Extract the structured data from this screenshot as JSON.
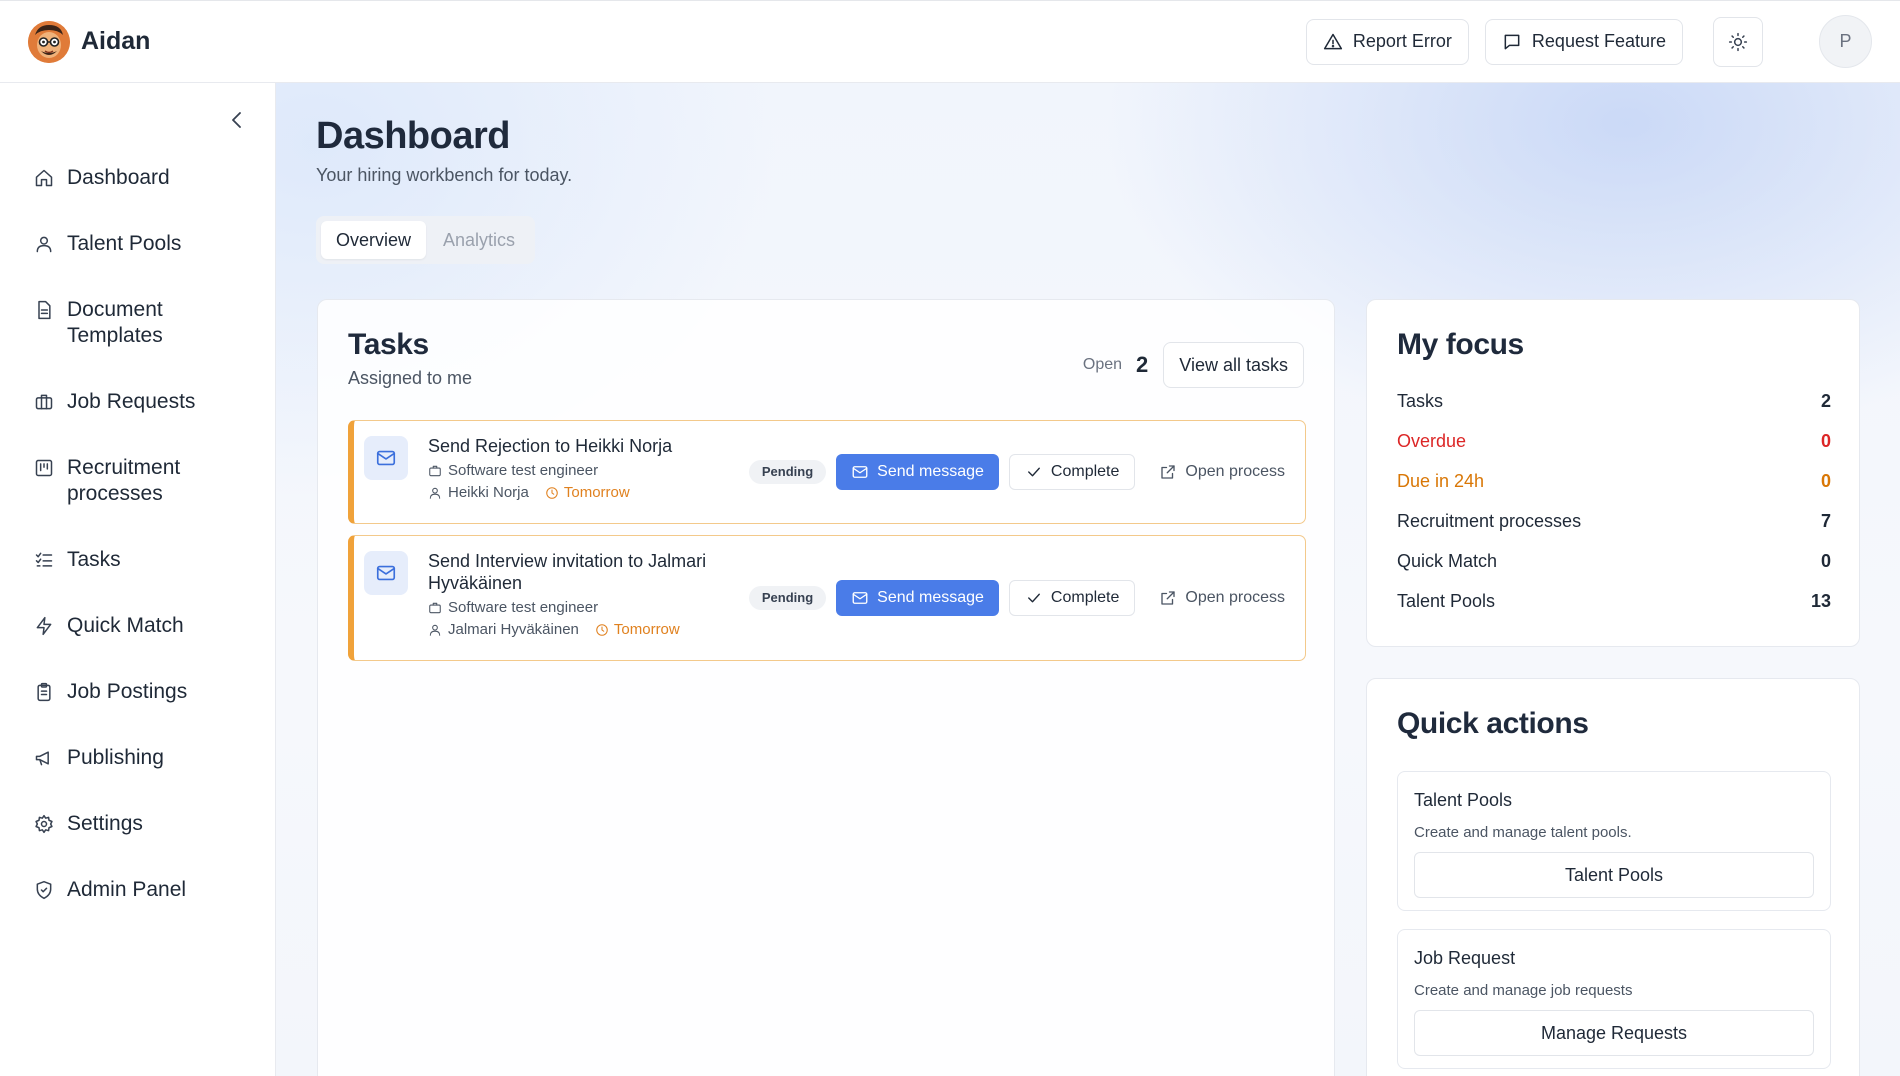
{
  "app": {
    "name": "Aidan"
  },
  "header": {
    "report_error": "Report Error",
    "request_feature": "Request Feature",
    "avatar_initial": "P"
  },
  "sidebar": {
    "items": [
      {
        "label": "Dashboard",
        "icon": "home-icon"
      },
      {
        "label": "Talent Pools",
        "icon": "user-icon"
      },
      {
        "label": "Document Templates",
        "icon": "document-icon"
      },
      {
        "label": "Job Requests",
        "icon": "briefcase-icon"
      },
      {
        "label": "Recruitment processes",
        "icon": "kanban-icon"
      },
      {
        "label": "Tasks",
        "icon": "checklist-icon"
      },
      {
        "label": "Quick Match",
        "icon": "lightning-icon"
      },
      {
        "label": "Job Postings",
        "icon": "clipboard-icon"
      },
      {
        "label": "Publishing",
        "icon": "megaphone-icon"
      },
      {
        "label": "Settings",
        "icon": "gear-icon"
      },
      {
        "label": "Admin Panel",
        "icon": "shield-icon"
      }
    ]
  },
  "page": {
    "title": "Dashboard",
    "subtitle": "Your hiring workbench for today.",
    "tabs": [
      {
        "label": "Overview",
        "active": true
      },
      {
        "label": "Analytics",
        "active": false
      }
    ]
  },
  "tasks": {
    "title": "Tasks",
    "subtitle": "Assigned to me",
    "open_label": "Open",
    "open_count": "2",
    "view_all": "View all tasks",
    "items": [
      {
        "title": "Send Rejection to Heikki Norja",
        "job": "Software test engineer",
        "person": "Heikki Norja",
        "due": "Tomorrow",
        "status": "Pending",
        "send": "Send message",
        "complete": "Complete",
        "open": "Open process"
      },
      {
        "title": "Send Interview invitation to Jalmari Hyväkäinen",
        "job": "Software test engineer",
        "person": "Jalmari Hyväkäinen",
        "due": "Tomorrow",
        "status": "Pending",
        "send": "Send message",
        "complete": "Complete",
        "open": "Open process"
      }
    ]
  },
  "focus": {
    "title": "My focus",
    "rows": [
      {
        "label": "Tasks",
        "value": "2",
        "color": "#1f2937"
      },
      {
        "label": "Overdue",
        "value": "0",
        "color": "#dc2626"
      },
      {
        "label": "Due in 24h",
        "value": "0",
        "color": "#d97706"
      },
      {
        "label": "Recruitment processes",
        "value": "7",
        "color": "#1f2937"
      },
      {
        "label": "Quick Match",
        "value": "0",
        "color": "#1f2937"
      },
      {
        "label": "Talent Pools",
        "value": "13",
        "color": "#1f2937"
      }
    ]
  },
  "quick_actions": {
    "title": "Quick actions",
    "items": [
      {
        "name": "Talent Pools",
        "desc": "Create and manage talent pools.",
        "button": "Talent Pools"
      },
      {
        "name": "Job Request",
        "desc": "Create and manage job requests",
        "button": "Manage Requests"
      }
    ]
  },
  "colors": {
    "accent": "#4a7ce8",
    "warning": "#f0a23a",
    "danger": "#dc2626"
  }
}
